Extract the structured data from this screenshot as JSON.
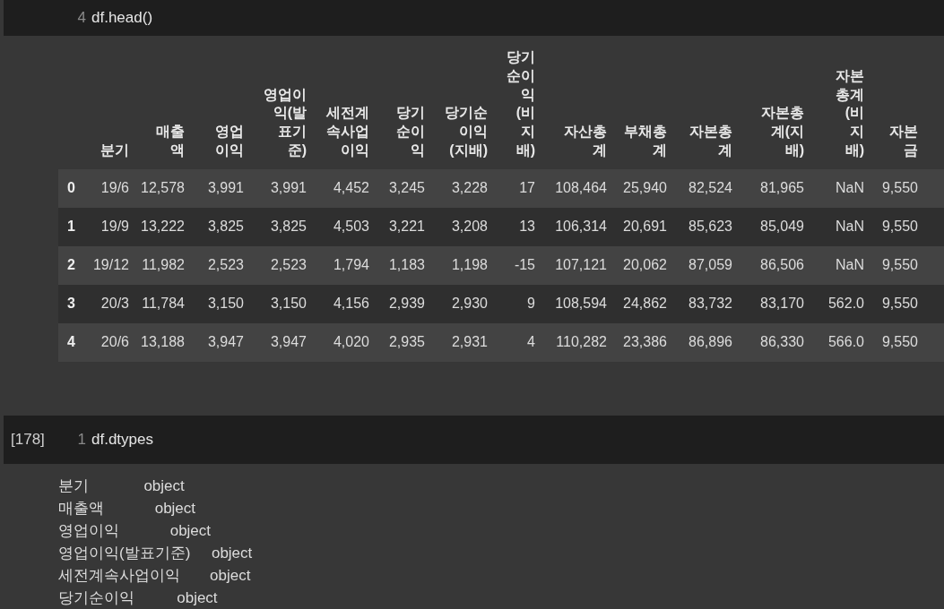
{
  "cell_1": {
    "line_number": "4",
    "code": "df.head()"
  },
  "table": {
    "columns": [
      "분기",
      "매출액",
      "영업이익",
      "영업이익(발표기준)",
      "세전계속사업이익",
      "당기순이익",
      "당기순이익(지배)",
      "당기순이익(비지배)",
      "자산총계",
      "부채총계",
      "자본총계",
      "자본총계(지배)",
      "자본총계(비지배)",
      "자본금"
    ],
    "rows": [
      {
        "index": "0",
        "values": [
          "19/6",
          "12,578",
          "3,991",
          "3,991",
          "4,452",
          "3,245",
          "3,228",
          "17",
          "108,464",
          "25,940",
          "82,524",
          "81,965",
          "NaN",
          "9,550"
        ]
      },
      {
        "index": "1",
        "values": [
          "19/9",
          "13,222",
          "3,825",
          "3,825",
          "4,503",
          "3,221",
          "3,208",
          "13",
          "106,314",
          "20,691",
          "85,623",
          "85,049",
          "NaN",
          "9,550"
        ]
      },
      {
        "index": "2",
        "values": [
          "19/12",
          "11,982",
          "2,523",
          "2,523",
          "1,794",
          "1,183",
          "1,198",
          "-15",
          "107,121",
          "20,062",
          "87,059",
          "86,506",
          "NaN",
          "9,550"
        ]
      },
      {
        "index": "3",
        "values": [
          "20/3",
          "11,784",
          "3,150",
          "3,150",
          "4,156",
          "2,939",
          "2,930",
          "9",
          "108,594",
          "24,862",
          "83,732",
          "83,170",
          "562.0",
          "9,550"
        ]
      },
      {
        "index": "4",
        "values": [
          "20/6",
          "13,188",
          "3,947",
          "3,947",
          "4,020",
          "2,935",
          "2,931",
          "4",
          "110,282",
          "23,386",
          "86,896",
          "86,330",
          "566.0",
          "9,550"
        ]
      }
    ]
  },
  "cell_2": {
    "prompt": "[178]",
    "line_number": "1",
    "code": "df.dtypes"
  },
  "dtypes_output": [
    "분기             object",
    "매출액            object",
    "영업이익            object",
    "영업이익(발표기준)     object",
    "세전계속사업이익       object",
    "당기순이익          object"
  ]
}
